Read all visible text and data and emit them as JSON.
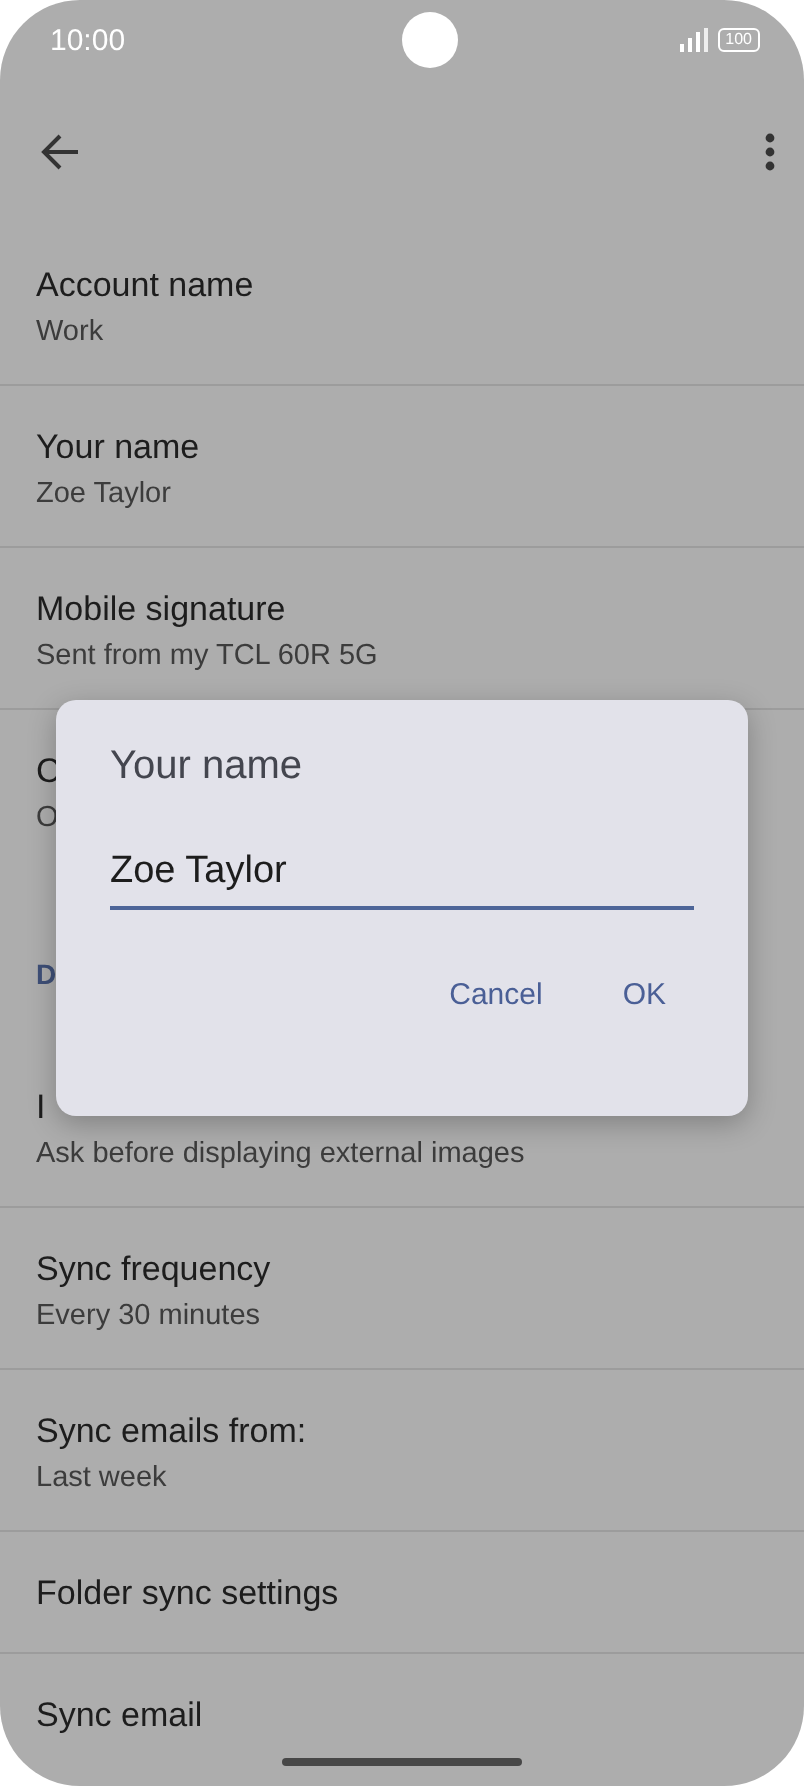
{
  "status_bar": {
    "time": "10:00",
    "battery": "100"
  },
  "settings": [
    {
      "kind": "item",
      "title": "Account name",
      "subtitle": "Work"
    },
    {
      "kind": "item",
      "title": "Your name",
      "subtitle": "Zoe Taylor"
    },
    {
      "kind": "item",
      "title": "Mobile signature",
      "subtitle": "Sent from my TCL 60R 5G"
    },
    {
      "kind": "item",
      "title": "C",
      "subtitle": "O"
    },
    {
      "kind": "header",
      "title": "D"
    },
    {
      "kind": "item",
      "title": "I",
      "subtitle": "Ask before displaying external images"
    },
    {
      "kind": "item",
      "title": "Sync frequency",
      "subtitle": "Every 30 minutes"
    },
    {
      "kind": "item",
      "title": "Sync emails from:",
      "subtitle": "Last week"
    },
    {
      "kind": "item",
      "title": "Folder sync settings"
    },
    {
      "kind": "item",
      "title": "Sync email"
    }
  ],
  "dialog": {
    "title": "Your name",
    "value": "Zoe Taylor",
    "buttons": [
      "Cancel",
      "OK"
    ]
  }
}
